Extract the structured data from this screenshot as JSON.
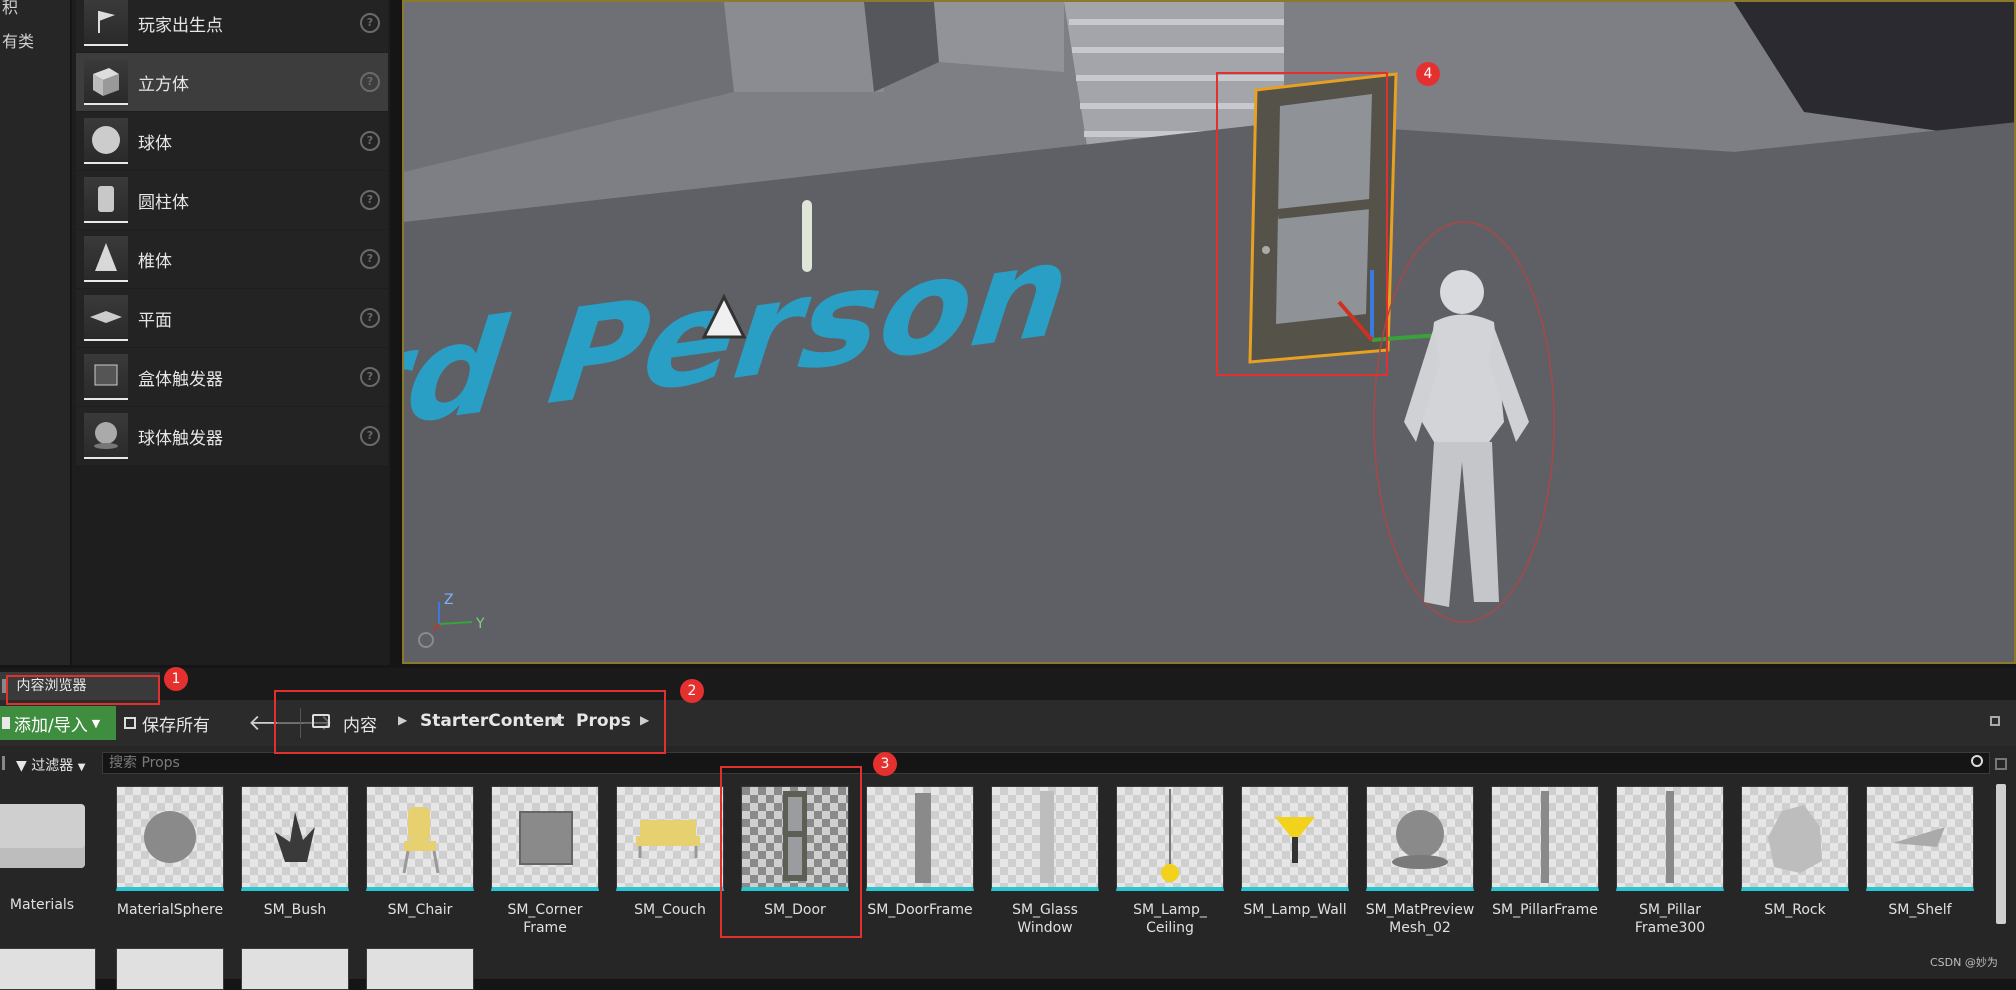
{
  "left_categories": [
    "积",
    "有类"
  ],
  "place_items": [
    {
      "label": "玩家出生点",
      "icon": "player-start-icon"
    },
    {
      "label": "立方体",
      "icon": "cube-icon",
      "selected": true
    },
    {
      "label": "球体",
      "icon": "sphere-icon"
    },
    {
      "label": "圆柱体",
      "icon": "cylinder-icon"
    },
    {
      "label": "椎体",
      "icon": "cone-icon"
    },
    {
      "label": "平面",
      "icon": "plane-icon"
    },
    {
      "label": "盒体触发器",
      "icon": "box-trigger-icon"
    },
    {
      "label": "球体触发器",
      "icon": "sphere-trigger-icon"
    }
  ],
  "viewport": {
    "floor_text": "ird Person",
    "axis": {
      "z": "Z",
      "y": "Y"
    }
  },
  "content_browser": {
    "tab_label": "内容浏览器",
    "add_import_label": "添加/导入",
    "save_all_label": "保存所有",
    "breadcrumb": [
      "内容",
      "StarterContent",
      "Props"
    ],
    "filter_label": "过滤器",
    "search_placeholder": "搜索 Props",
    "assets": [
      {
        "name": "Materials",
        "kind": "folder"
      },
      {
        "name": "MaterialSphere",
        "kind": "sphere"
      },
      {
        "name": "SM_Bush",
        "kind": "bush"
      },
      {
        "name": "SM_Chair",
        "kind": "chair"
      },
      {
        "name": "SM_Corner\nFrame",
        "kind": "box"
      },
      {
        "name": "SM_Couch",
        "kind": "couch"
      },
      {
        "name": "SM_Door",
        "kind": "door",
        "selected": true
      },
      {
        "name": "SM_DoorFrame",
        "kind": "doorframe"
      },
      {
        "name": "SM_Glass\nWindow",
        "kind": "glass"
      },
      {
        "name": "SM_Lamp_\nCeiling",
        "kind": "lamp-ceiling"
      },
      {
        "name": "SM_Lamp_Wall",
        "kind": "lamp-wall"
      },
      {
        "name": "SM_MatPreview\nMesh_02",
        "kind": "matpreview"
      },
      {
        "name": "SM_PillarFrame",
        "kind": "pillar"
      },
      {
        "name": "SM_Pillar\nFrame300",
        "kind": "pillar"
      },
      {
        "name": "SM_Rock",
        "kind": "rock"
      },
      {
        "name": "SM_Shelf",
        "kind": "shelf"
      }
    ]
  },
  "annotations": [
    "1",
    "2",
    "3",
    "4"
  ],
  "watermark": "CSDN @妙为",
  "colors": {
    "accent_green": "#3f8d3f",
    "asset_underline": "#27c5d0",
    "annotation_red": "#e53030",
    "viewport_border": "#8a7a2a"
  }
}
